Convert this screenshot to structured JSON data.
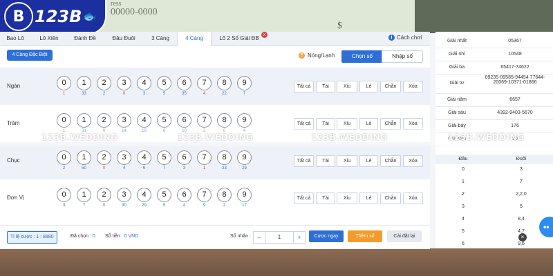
{
  "background": {
    "banknote_text": "ress",
    "banknote_number": "00000-0000",
    "dollar_sign": "$"
  },
  "logo": {
    "badge": "B",
    "text": "123B",
    "fish": "🐟"
  },
  "tabs": [
    {
      "label": "Bao Lô"
    },
    {
      "label": "Lô Xiên"
    },
    {
      "label": "Đánh Đề"
    },
    {
      "label": "Đầu Đuôi"
    },
    {
      "label": "3 Càng"
    },
    {
      "label": "4 Càng"
    },
    {
      "label": "Lô 2 Số Giải ĐB"
    }
  ],
  "active_tab": "4 Càng",
  "tab_badge": "x",
  "howto": {
    "icon": "i",
    "label": "Cách chơi"
  },
  "sub_type_label": "4 Càng Đặc Biệt",
  "hotcold": {
    "icon": "?",
    "label": "Nóng/Lạnh"
  },
  "mode": {
    "pick_label": "Chọn số",
    "input_label": "Nhập số"
  },
  "rows": [
    {
      "label": "Ngàn",
      "freq": [
        "1",
        "33",
        "2",
        "0",
        "3",
        "5",
        "35",
        "4",
        "22",
        "7"
      ],
      "hot": [
        0,
        3,
        7
      ]
    },
    {
      "label": "Trăm",
      "freq": [
        "1",
        "31",
        "0",
        "14",
        "19",
        "6",
        "10",
        "2",
        "0",
        "4"
      ],
      "hot": [
        0,
        2,
        7,
        8
      ]
    },
    {
      "label": "Chục",
      "freq": [
        "2",
        "50",
        "0",
        "4",
        "6",
        "7",
        "3",
        "1",
        "23",
        "29"
      ],
      "hot": [
        2,
        7
      ]
    },
    {
      "label": "Đơn Vị",
      "freq": [
        "3",
        "7",
        "0",
        "30",
        "29",
        "5",
        "4",
        "9",
        "2",
        "17"
      ],
      "hot": [
        2
      ]
    }
  ],
  "digits": [
    "0",
    "1",
    "2",
    "3",
    "4",
    "5",
    "6",
    "7",
    "8",
    "9"
  ],
  "row_buttons": [
    "Tất cả",
    "Tài",
    "Xỉu",
    "Lẻ",
    "Chẵn",
    "Xóa"
  ],
  "footer": {
    "ratio_label": "Tỉ lệ cược : 1 : 8880",
    "picked_label": "Đã chọn :",
    "picked_value": "0",
    "amount_label": "Số tiền :",
    "amount_value": "0 VND",
    "multiplier_label": "Số nhân :",
    "minus": "−",
    "multiplier_value": "1",
    "plus": "+",
    "bet_now": "Cược ngay",
    "add_number": "Thêm số",
    "reset": "Cài đặt lại"
  },
  "results": [
    {
      "prize": "Giải nhất",
      "value": "05367"
    },
    {
      "prize": "Giải nhì",
      "value": "10548"
    },
    {
      "prize": "Giải ba",
      "value": "65417-74622"
    },
    {
      "prize": "Giải tư",
      "value": "09235-09585-94454 77644-20069-10371-01866"
    },
    {
      "prize": "Giải năm",
      "value": "6657"
    },
    {
      "prize": "Giải sáu",
      "value": "4392-9403-5670"
    },
    {
      "prize": "Giải bảy",
      "value": "176"
    },
    {
      "prize": "Giải tám",
      "value": "20"
    }
  ],
  "headtail": {
    "head_label": "Đầu",
    "tail_label": "Đuôi",
    "rows": [
      {
        "head": "0",
        "tail": "3"
      },
      {
        "head": "1",
        "tail": "7"
      },
      {
        "head": "2",
        "tail": "2,2,0"
      },
      {
        "head": "3",
        "tail": "5"
      },
      {
        "head": "4",
        "tail": "8,4"
      },
      {
        "head": "5",
        "tail": "4,7"
      },
      {
        "head": "6",
        "tail": "9,6"
      }
    ]
  },
  "watermark_text": "123B.WEDDING",
  "chat_dots": "••",
  "close_x": "×",
  "colors": {
    "accent": "#2d6fd6",
    "hot": "#e0403a",
    "orange": "#f39b2b",
    "brand": "#1b2fa0"
  }
}
